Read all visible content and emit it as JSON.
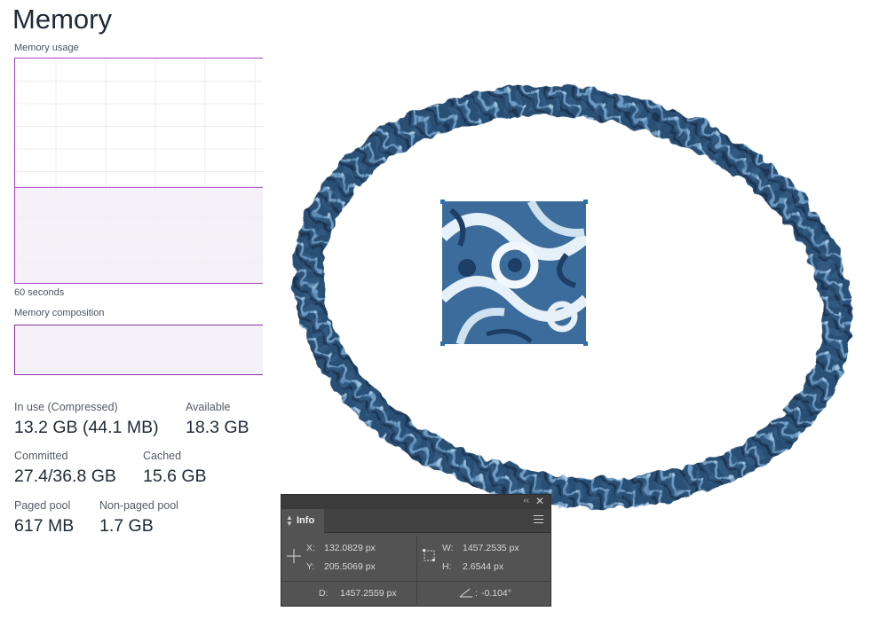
{
  "memory_pane": {
    "title": "Memory",
    "usage_label": "Memory usage",
    "time_label": "60 seconds",
    "usage_fraction": 0.43,
    "composition_label": "Memory composition",
    "stats": {
      "in_use_label": "In use (Compressed)",
      "in_use_value": "13.2 GB (44.1 MB)",
      "available_label": "Available",
      "available_value": "18.3 GB",
      "committed_label": "Committed",
      "committed_value": "27.4/36.8 GB",
      "cached_label": "Cached",
      "cached_value": "15.6 GB",
      "paged_pool_label": "Paged pool",
      "paged_pool_value": "617 MB",
      "non_paged_pool_label": "Non-paged pool",
      "non_paged_pool_value": "1.7 GB"
    },
    "colors": {
      "accent": "#a845c4",
      "fill": "#f3eff7"
    }
  },
  "info_panel": {
    "tab_label": "Info",
    "x_label": "X:",
    "x_value": "132.0829 px",
    "y_label": "Y:",
    "y_value": "205.5069 px",
    "w_label": "W:",
    "w_value": "1457.2535 px",
    "h_label": "H:",
    "h_value": "2.6544 px",
    "d_label": "D:",
    "d_value": "1457.2559 px",
    "angle_value": "-0.104°",
    "icons": [
      "crosshair-icon",
      "transform-box-icon",
      "angle-icon",
      "panel-menu-icon",
      "collapse-icon",
      "close-icon"
    ]
  },
  "canvas": {
    "colors": {
      "dark_blue": "#27496d",
      "mid_blue": "#3d6f9c",
      "light_blue": "#9ec3df",
      "pale": "#e8f1f8"
    }
  }
}
